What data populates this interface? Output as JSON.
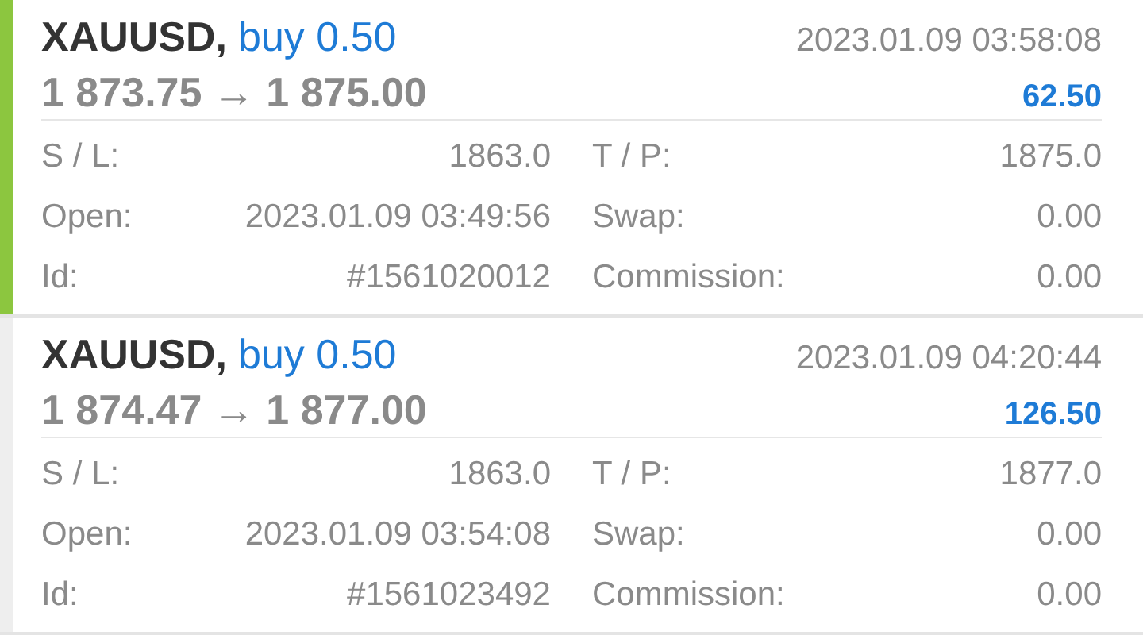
{
  "trades": [
    {
      "symbol": "XAUUSD,",
      "side": "buy 0.50",
      "time": "2023.01.09 03:58:08",
      "prices": "1 873.75 → 1 875.00",
      "profit": "62.50",
      "selected": true,
      "details": [
        {
          "label": "S / L:",
          "value": "1863.0"
        },
        {
          "label": "T / P:",
          "value": "1875.0"
        },
        {
          "label": "Open:",
          "value": "2023.01.09 03:49:56"
        },
        {
          "label": "Swap:",
          "value": "0.00"
        },
        {
          "label": "Id:",
          "value": "#1561020012"
        },
        {
          "label": "Commission:",
          "value": "0.00"
        }
      ]
    },
    {
      "symbol": "XAUUSD,",
      "side": "buy 0.50",
      "time": "2023.01.09 04:20:44",
      "prices": "1 874.47 → 1 877.00",
      "profit": "126.50",
      "selected": false,
      "details": [
        {
          "label": "S / L:",
          "value": "1863.0"
        },
        {
          "label": "T / P:",
          "value": "1877.0"
        },
        {
          "label": "Open:",
          "value": "2023.01.09 03:54:08"
        },
        {
          "label": "Swap:",
          "value": "0.00"
        },
        {
          "label": "Id:",
          "value": "#1561023492"
        },
        {
          "label": "Commission:",
          "value": "0.00"
        }
      ]
    }
  ]
}
